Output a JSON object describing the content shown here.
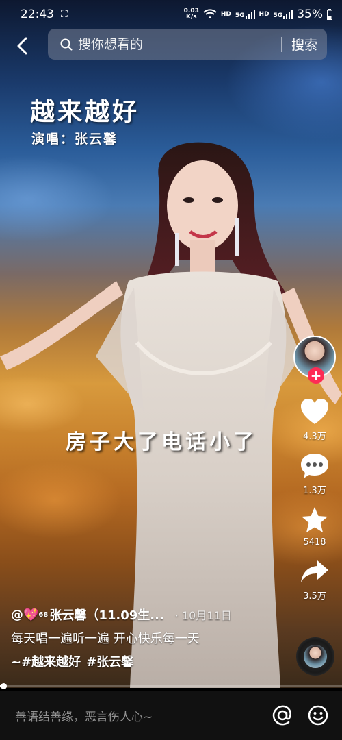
{
  "status_bar": {
    "time": "22:43",
    "net_speed_value": "0.03",
    "net_speed_unit": "K/s",
    "hd1": "HD",
    "signal1": "5G",
    "hd2": "HD",
    "signal2": "5G",
    "battery": "35%"
  },
  "search": {
    "placeholder": "搜你想看的",
    "button_label": "搜索"
  },
  "video": {
    "song_title": "越来越好",
    "singer_line": "演唱：张云馨",
    "lyric_line": "房子大了电话小了"
  },
  "actions": {
    "follow_symbol": "+",
    "like_count": "4.3万",
    "comment_count": "1.3万",
    "favorite_count": "5418",
    "share_count": "3.5万"
  },
  "caption": {
    "author_prefix": "@💖",
    "author_sup": "68",
    "author_name": "张云馨（11.09生...",
    "date": "· 10月11日",
    "text": "每天唱一遍听一遍 开心快乐每一天",
    "hashtag_prefix": "~",
    "hashtags": [
      "#越来越好",
      "#张云馨"
    ]
  },
  "progress": {
    "fraction": 0.01
  },
  "comment_bar": {
    "placeholder": "善语结善缘，恶言伤人心~"
  },
  "icons": {
    "back": "chevron-left-icon",
    "search": "magnifier-icon",
    "like": "heart-icon",
    "comment": "speech-bubble-icon",
    "favorite": "star-icon",
    "share": "share-arrow-icon",
    "mention": "at-icon",
    "emoji": "smiley-icon"
  },
  "colors": {
    "follow_badge": "#fe2c55",
    "comment_bar_bg": "#111111"
  }
}
